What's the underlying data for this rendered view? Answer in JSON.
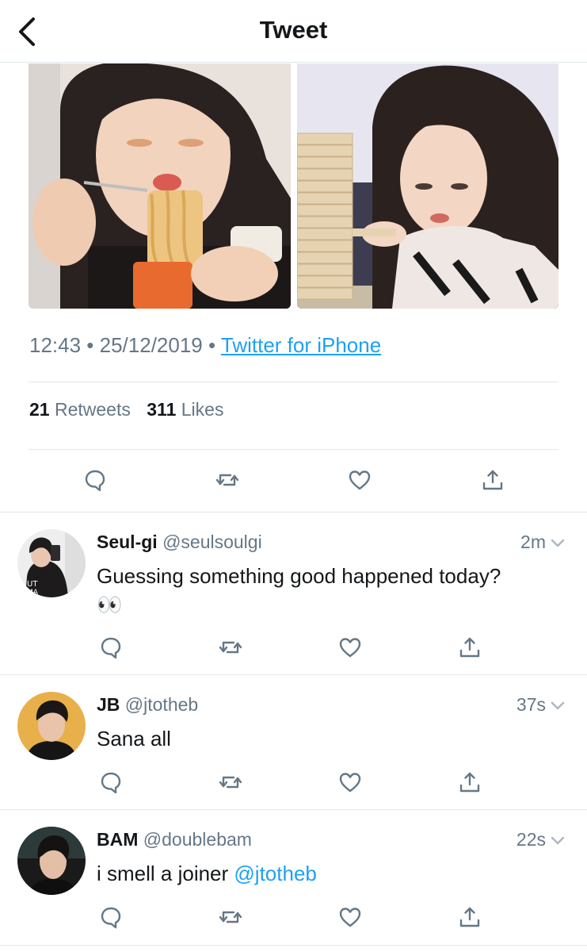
{
  "header": {
    "title": "Tweet"
  },
  "tweet": {
    "time": "12:43",
    "sep": " • ",
    "date": "25/12/2019",
    "source": "Twitter for iPhone",
    "retweets_count": "21",
    "retweets_label": "Retweets",
    "likes_count": "311",
    "likes_label": "Likes"
  },
  "replies": [
    {
      "display_name": "Seul-gi",
      "handle": "@seulsoulgi",
      "time": "2m",
      "text": "Guessing something good happened today?",
      "emoji": "👀",
      "mention": ""
    },
    {
      "display_name": "JB",
      "handle": "@jtotheb",
      "time": "37s",
      "text": "Sana all",
      "emoji": "",
      "mention": ""
    },
    {
      "display_name": "BAM",
      "handle": "@doublebam",
      "time": "22s",
      "text": "i smell a joiner ",
      "emoji": "",
      "mention": "@jtotheb"
    }
  ],
  "icons": [
    "back-arrow-icon",
    "reply-icon",
    "retweet-icon",
    "like-icon",
    "share-icon",
    "chevron-down-icon"
  ],
  "colors": {
    "link": "#1da1f2",
    "secondary_text": "#657786",
    "divider": "#e1e8ed",
    "icon": "#657786"
  }
}
